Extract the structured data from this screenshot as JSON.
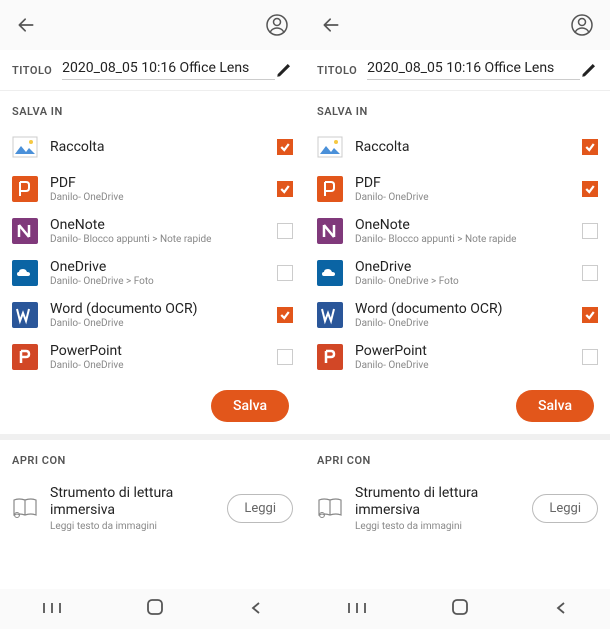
{
  "title_label": "TITOLO",
  "title_value": "2020_08_05 10:16 Office Lens",
  "save_in_label": "SALVA IN",
  "save_items": [
    {
      "title": "Raccolta",
      "sub": "",
      "checked": true,
      "icon": "gallery"
    },
    {
      "title": "PDF",
      "sub": "Danilo- OneDrive",
      "checked": true,
      "icon": "pdf"
    },
    {
      "title": "OneNote",
      "sub": "Danilo- Blocco appunti > Note rapide",
      "checked": false,
      "icon": "onenote"
    },
    {
      "title": "OneDrive",
      "sub": "Danilo- OneDrive > Foto",
      "checked": false,
      "icon": "onedrive"
    },
    {
      "title": "Word (documento OCR)",
      "sub": "Danilo- OneDrive",
      "checked": true,
      "icon": "word"
    },
    {
      "title": "PowerPoint",
      "sub": "Danilo- OneDrive",
      "checked": false,
      "icon": "powerpoint"
    }
  ],
  "save_button": "Salva",
  "open_with_label": "APRI CON",
  "open_item": {
    "title": "Strumento di lettura immersiva",
    "sub": "Leggi testo da immagini",
    "button": "Leggi"
  },
  "icon_colors": {
    "gallery": "#fff",
    "pdf": "#e2561b",
    "onenote": "#80397b",
    "onedrive": "#0a64a4",
    "word": "#2a5699",
    "powerpoint": "#d24726"
  }
}
